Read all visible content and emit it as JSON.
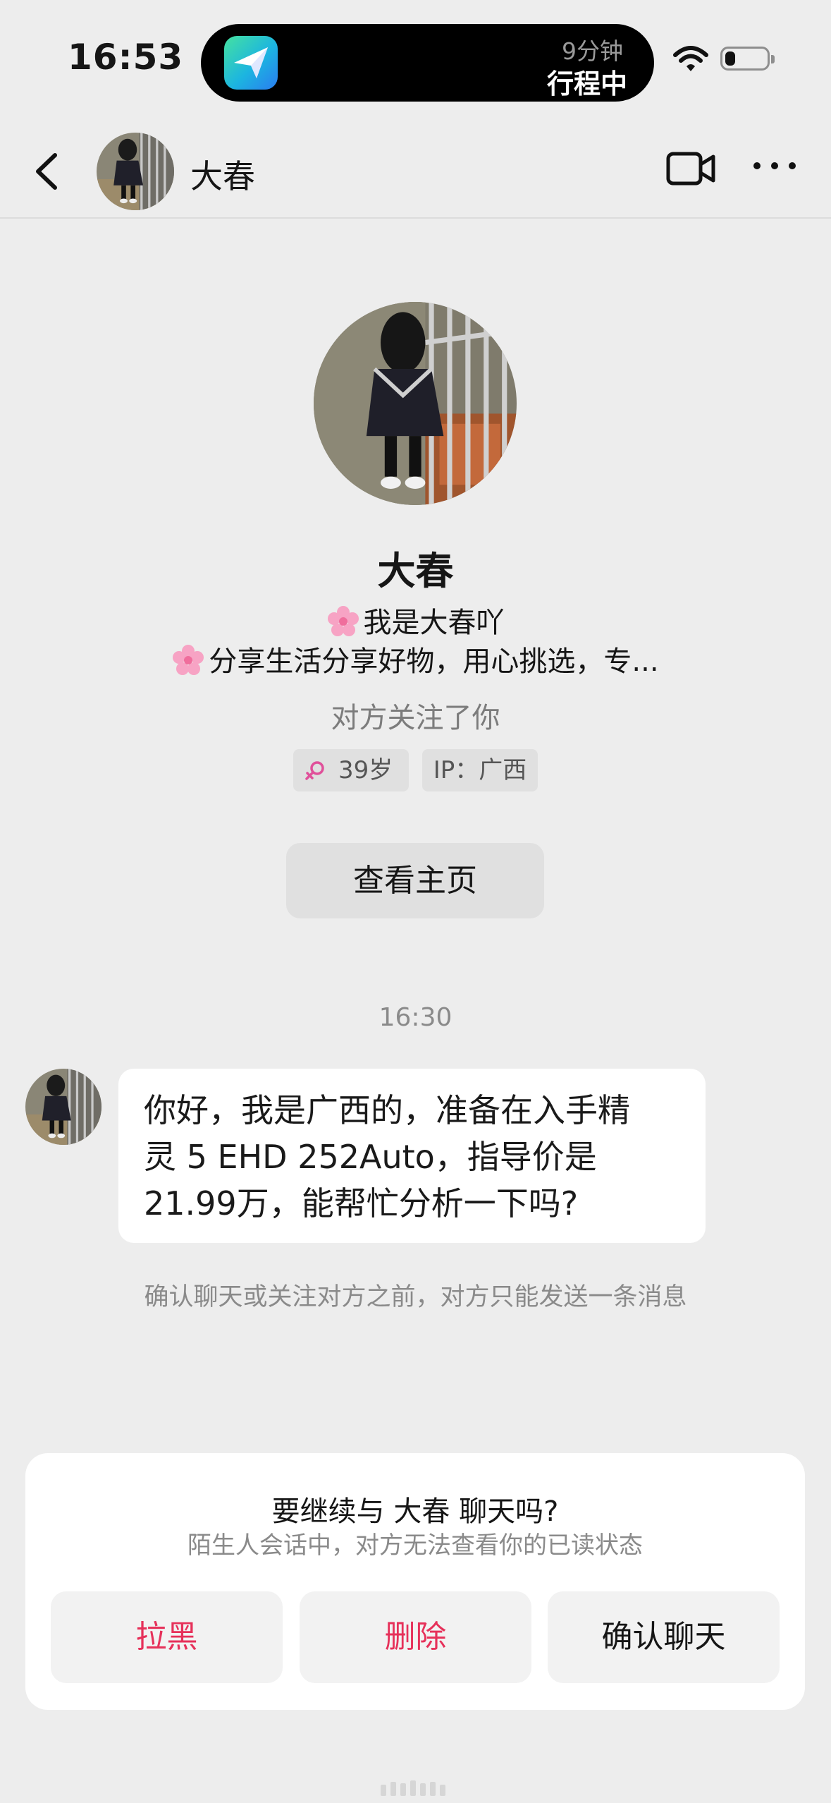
{
  "status_bar": {
    "time": "16:53",
    "live_activity": {
      "sub": "9分钟",
      "main": "行程中",
      "app_icon": "paper-plane-icon"
    },
    "battery_level": 0.25
  },
  "header": {
    "name": "大春",
    "icons": [
      "back-chevron-icon",
      "video-call-icon",
      "more-icon"
    ]
  },
  "profile": {
    "name": "大春",
    "bio_line1": "我是大春吖",
    "bio_line2": "分享生活分享好物，用心挑选，专...",
    "follow_note": "对方关注了你",
    "age": "39岁",
    "ip": "IP：广西",
    "homepage_button": "查看主页"
  },
  "chat": {
    "timestamp": "16:30",
    "message_lines": [
      "你好，我是广西的，准备在入手精",
      "灵 5 EHD 252Auto，指导价是",
      "21.99万，能帮忙分析一下吗?"
    ],
    "limit_note": "确认聊天或关注对方之前，对方只能发送一条消息"
  },
  "prompt_card": {
    "title": "要继续与 大春 聊天吗?",
    "subtitle": "陌生人会话中，对方无法查看你的已读状态",
    "buttons": {
      "block": "拉黑",
      "delete": "删除",
      "confirm": "确认聊天"
    }
  },
  "colors": {
    "background": "#EDEDED",
    "danger": "#E6315A",
    "bubble": "#FFFFFF",
    "tag_bg": "#E0E0E0"
  }
}
